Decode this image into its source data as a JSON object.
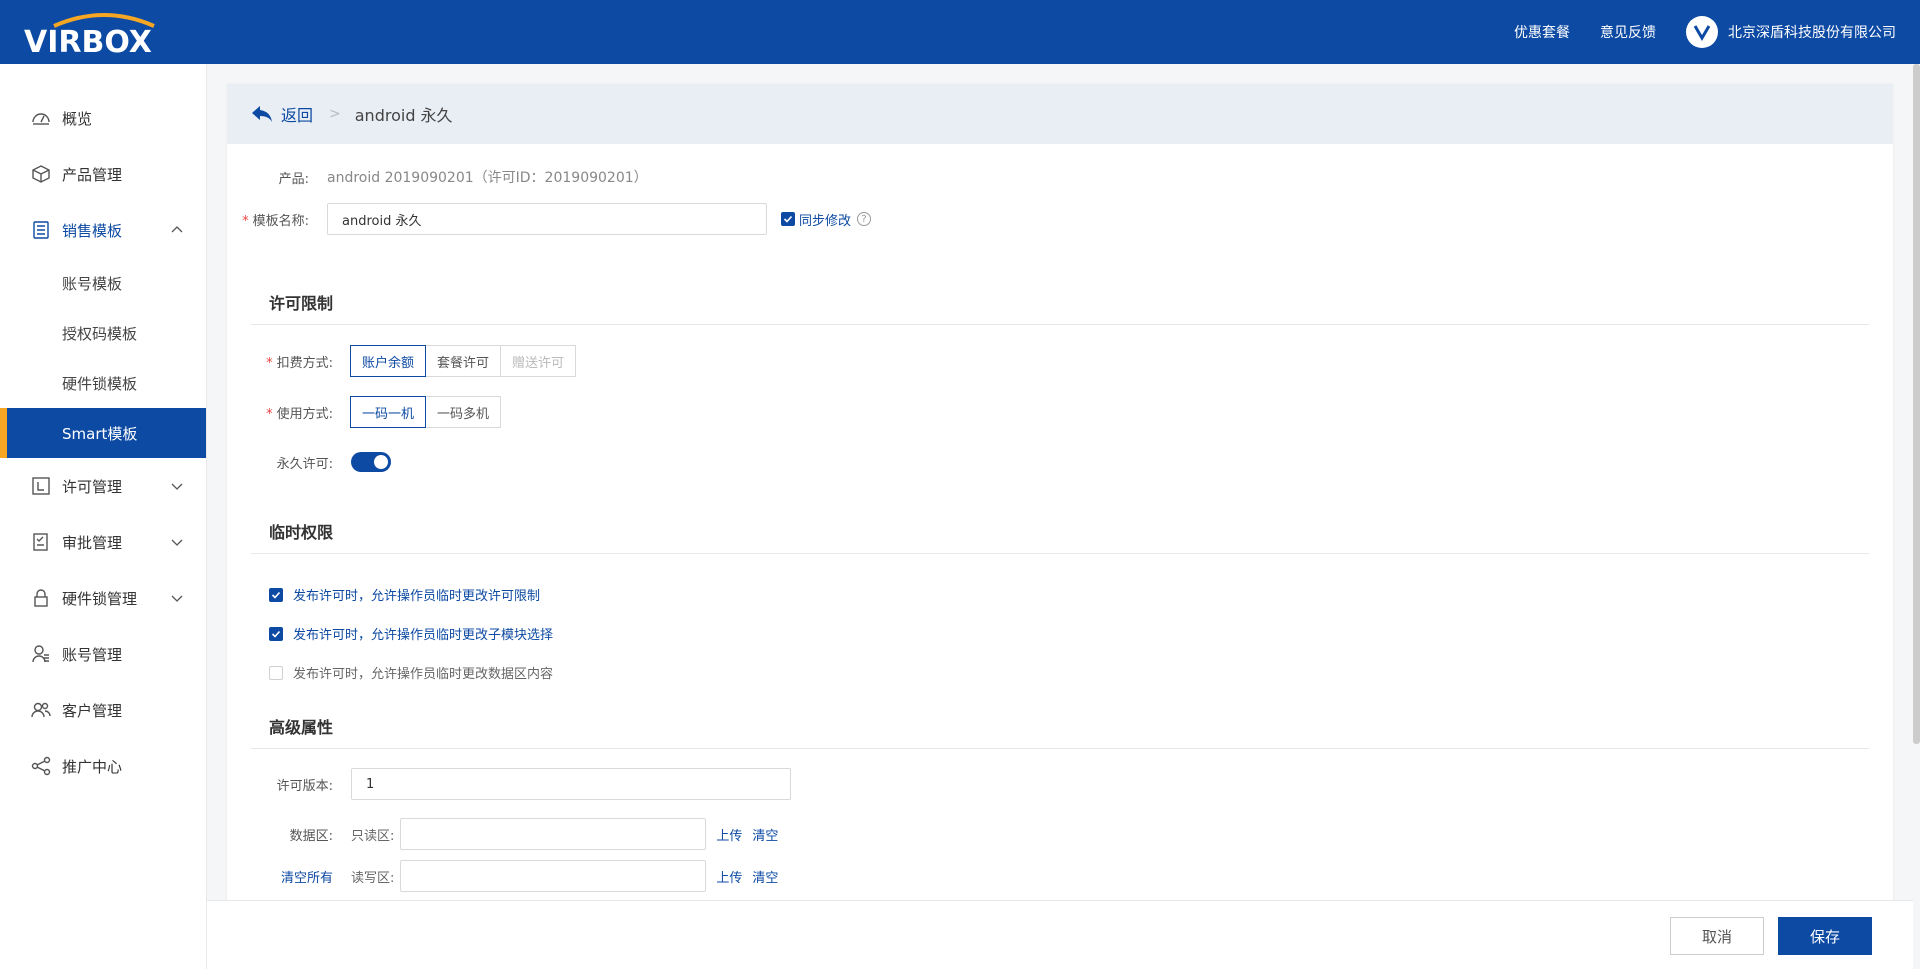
{
  "header": {
    "logo_text": "VIRBOX",
    "links": [
      "优惠套餐",
      "意见反馈"
    ],
    "company": "北京深盾科技股份有限公司"
  },
  "sidebar": {
    "items": [
      {
        "label": "概览",
        "icon": "dashboard-icon"
      },
      {
        "label": "产品管理",
        "icon": "box-icon"
      },
      {
        "label": "销售模板",
        "icon": "list-icon",
        "expanded": true
      },
      {
        "label": "许可管理",
        "icon": "license-icon"
      },
      {
        "label": "审批管理",
        "icon": "approval-icon"
      },
      {
        "label": "硬件锁管理",
        "icon": "lock-icon"
      },
      {
        "label": "账号管理",
        "icon": "user-icon"
      },
      {
        "label": "客户管理",
        "icon": "customers-icon"
      },
      {
        "label": "推广中心",
        "icon": "share-icon"
      }
    ],
    "sub_items": [
      "账号模板",
      "授权码模板",
      "硬件锁模板",
      "Smart模板"
    ],
    "active_sub": "Smart模板"
  },
  "breadcrumb": {
    "back": "返回",
    "current": "android 永久"
  },
  "form": {
    "product_label": "产品:",
    "product_value": "android 2019090201（许可ID：2019090201）",
    "name_label": "模板名称:",
    "name_value": "android 永久",
    "sync_label": "同步修改",
    "sync_checked": true,
    "help_glyph": "?"
  },
  "license_limit": {
    "title": "许可限制",
    "charge_label": "扣费方式:",
    "charge_options": [
      "账户余额",
      "套餐许可",
      "赠送许可"
    ],
    "charge_selected": "账户余额",
    "usage_label": "使用方式:",
    "usage_options": [
      "一码一机",
      "一码多机"
    ],
    "usage_selected": "一码一机",
    "perm_label": "永久许可:",
    "perm_on": true
  },
  "temp_perm": {
    "title": "临时权限",
    "options": [
      {
        "label": "发布许可时，允许操作员临时更改许可限制",
        "checked": true
      },
      {
        "label": "发布许可时，允许操作员临时更改子模块选择",
        "checked": true
      },
      {
        "label": "发布许可时，允许操作员临时更改数据区内容",
        "checked": false
      }
    ]
  },
  "advanced": {
    "title": "高级属性",
    "version_label": "许可版本:",
    "version_value": "1",
    "data_label": "数据区:",
    "clear_all": "清空所有",
    "readonly_label": "只读区:",
    "readwrite_label": "读写区:",
    "upload": "上传",
    "clear": "清空"
  },
  "footer": {
    "cancel": "取消",
    "save": "保存"
  },
  "colors": {
    "primary": "#0d4aa3",
    "accent": "#f5a623"
  }
}
